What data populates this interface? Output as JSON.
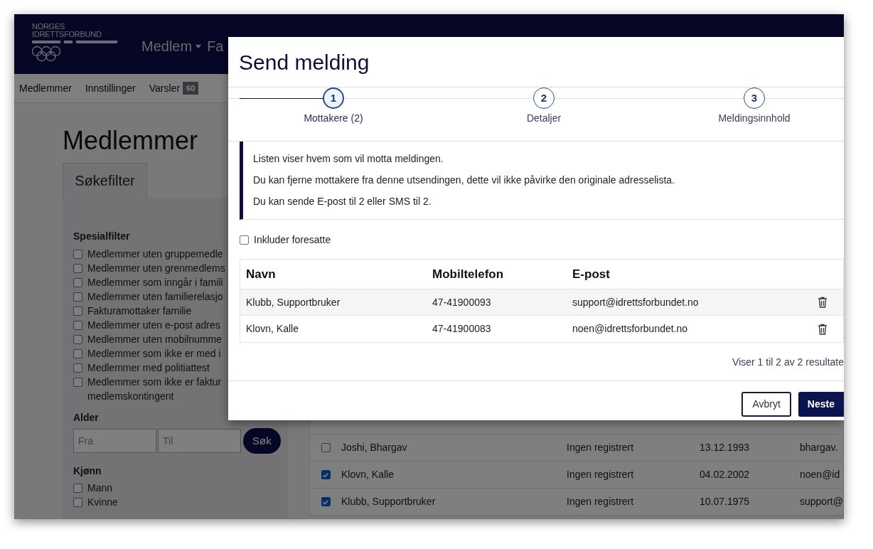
{
  "header": {
    "logo_lines": [
      "NORGES",
      "IDRETTSFORBUND"
    ],
    "menu": [
      {
        "label": "Medlem",
        "dropdown": true
      },
      {
        "label": "Fa",
        "dropdown": false
      }
    ]
  },
  "nav": [
    {
      "label": "Medlemmer"
    },
    {
      "label": "Innstillinger"
    },
    {
      "label": "Varsler",
      "badge": "60"
    }
  ],
  "page_title": "Medlemmer",
  "filter_tab": "Søkefilter",
  "special_filter": {
    "heading": "Spesialfilter",
    "options": [
      {
        "label": "Medlemmer uten gruppemedle",
        "checked": false
      },
      {
        "label": "Medlemmer uten grenmedlems",
        "checked": false
      },
      {
        "label": "Medlemmer som inngår i famili",
        "checked": false
      },
      {
        "label": "Medlemmer uten familierelasjo",
        "checked": false
      },
      {
        "label": "Fakturamottaker familie",
        "checked": false
      },
      {
        "label": "Medlemmer uten e-post adres",
        "checked": false
      },
      {
        "label": "Medlemmer uten mobilnumme",
        "checked": false
      },
      {
        "label": "Medlemmer som ikke er med i",
        "checked": false
      },
      {
        "label": "Medlemmer med politiattest",
        "checked": false
      },
      {
        "label": "Medlemmer som ikke er faktur",
        "continuation": "medlemskontingent",
        "checked": false
      }
    ]
  },
  "age": {
    "heading": "Alder",
    "from_placeholder": "Fra",
    "to_placeholder": "Til",
    "button": "Søk"
  },
  "gender": {
    "heading": "Kjønn",
    "options": [
      {
        "label": "Mann",
        "checked": false
      },
      {
        "label": "Kvinne",
        "checked": false
      }
    ]
  },
  "members_table": {
    "rows": [
      {
        "checked": false,
        "name": "Joshi, Bhargav",
        "mobile": "Ingen registrert",
        "date": "13.12.1993",
        "column_4": "bhargav."
      },
      {
        "checked": true,
        "name": "Klovn, Kalle",
        "mobile": "Ingen registrert",
        "date": "04.02.2002",
        "column_4": "noen@id"
      },
      {
        "checked": true,
        "name": "Klubb, Supportbruker",
        "mobile": "Ingen registrert",
        "date": "10.07.1975",
        "column_4": "support@"
      }
    ]
  },
  "dialog": {
    "title": "Send melding",
    "steps": [
      {
        "number": "1",
        "label": "Mottakere (2)",
        "selected": true
      },
      {
        "number": "2",
        "label": "Detaljer",
        "selected": false
      },
      {
        "number": "3",
        "label": "Meldingsinnhold",
        "selected": false
      }
    ],
    "info": [
      "Listen viser hvem som vil motta meldingen.",
      "Du kan fjerne mottakere fra denne utsendingen, dette vil ikke påvirke den originale adresselista.",
      "Du kan sende E-post til 2 eller SMS til 2."
    ],
    "include_guardians": {
      "label": "Inkluder foresatte",
      "checked": false
    },
    "table": {
      "columns": [
        "Navn",
        "Mobiltelefon",
        "E-post"
      ],
      "rows": [
        {
          "name": "Klubb, Supportbruker",
          "mobile": "47-41900093",
          "email": "support@idrettsforbundet.no"
        },
        {
          "name": "Klovn, Kalle",
          "mobile": "47-41900083",
          "email": "noen@idrettsforbundet.no"
        }
      ]
    },
    "result_text": "Viser 1 til 2 av 2 resultate",
    "buttons": [
      {
        "label": "Avbryt",
        "kind": "secondary"
      },
      {
        "label": "Neste",
        "kind": "primary"
      }
    ]
  }
}
